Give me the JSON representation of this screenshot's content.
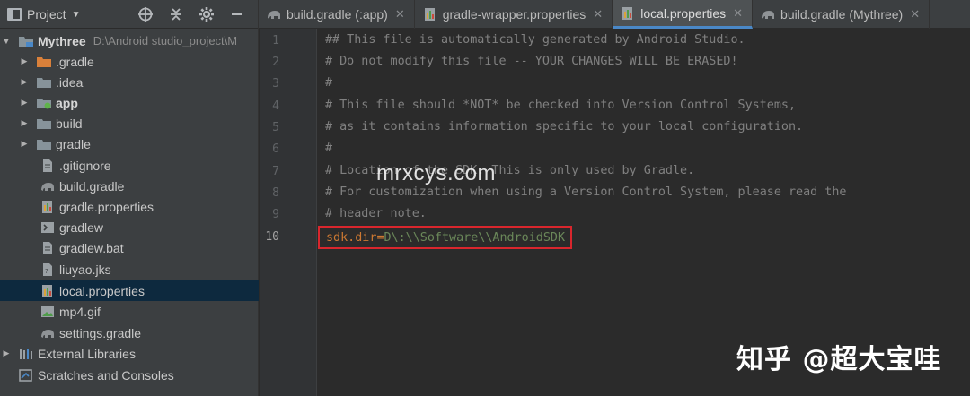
{
  "project_panel": {
    "title": "Project",
    "tools": [
      "crosshair-icon",
      "collapse-icon",
      "gear-icon",
      "minimize-icon"
    ]
  },
  "tabs": [
    {
      "label": "build.gradle (:app)",
      "icon": "gradle-elephant-icon",
      "active": false
    },
    {
      "label": "gradle-wrapper.properties",
      "icon": "properties-file-icon",
      "active": false
    },
    {
      "label": "local.properties",
      "icon": "properties-file-icon",
      "active": true
    },
    {
      "label": "build.gradle (Mythree)",
      "icon": "gradle-elephant-icon",
      "active": false
    }
  ],
  "tree": [
    {
      "label": "Mythree",
      "path": "D:\\Android studio_project\\M",
      "icon": "module-folder-icon",
      "indent": 0,
      "expanded": true,
      "bold": true
    },
    {
      "label": ".gradle",
      "icon": "orange-folder-icon",
      "indent": 1,
      "expanded": false
    },
    {
      "label": ".idea",
      "icon": "folder-icon",
      "indent": 1,
      "expanded": false
    },
    {
      "label": "app",
      "icon": "android-module-folder-icon",
      "indent": 1,
      "expanded": false,
      "bold": true
    },
    {
      "label": "build",
      "icon": "folder-icon",
      "indent": 1,
      "expanded": false
    },
    {
      "label": "gradle",
      "icon": "folder-icon",
      "indent": 1,
      "expanded": false
    },
    {
      "label": ".gitignore",
      "icon": "text-file-icon",
      "indent": 2
    },
    {
      "label": "build.gradle",
      "icon": "gradle-elephant-icon",
      "indent": 2
    },
    {
      "label": "gradle.properties",
      "icon": "properties-file-icon",
      "indent": 2
    },
    {
      "label": "gradlew",
      "icon": "terminal-file-icon",
      "indent": 2
    },
    {
      "label": "gradlew.bat",
      "icon": "text-file-icon",
      "indent": 2
    },
    {
      "label": "liuyao.jks",
      "icon": "keystore-file-icon",
      "indent": 2
    },
    {
      "label": "local.properties",
      "icon": "properties-file-icon",
      "indent": 2,
      "selected": true
    },
    {
      "label": "mp4.gif",
      "icon": "image-file-icon",
      "indent": 2
    },
    {
      "label": "settings.gradle",
      "icon": "gradle-elephant-icon",
      "indent": 2
    },
    {
      "label": "External Libraries",
      "icon": "libraries-icon",
      "indent": 0,
      "expanded": false
    },
    {
      "label": "Scratches and Consoles",
      "icon": "scratches-icon",
      "indent": 0
    }
  ],
  "editor": {
    "current_line": 10,
    "lines": [
      "## This file is automatically generated by Android Studio.",
      "# Do not modify this file -- YOUR CHANGES WILL BE ERASED!",
      "#",
      "# This file should *NOT* be checked into Version Control Systems,",
      "# as it contains information specific to your local configuration.",
      "#",
      "# Location of the SDK. This is only used by Gradle.",
      "# For customization when using a Version Control System, please read the",
      "# header note."
    ],
    "last_line": {
      "key": "sdk.dir",
      "eq": "=",
      "value": "D\\:\\\\Software\\\\AndroidSDK"
    }
  },
  "watermark": "mrxcys.com",
  "brand": "知乎 @超大宝哇",
  "colors": {
    "tree_bg": "#3c3f41",
    "editor_bg": "#2b2b2b",
    "selection_bg": "#0d293e",
    "comment": "#808080",
    "key": "#cc7832",
    "value": "#6a8759",
    "highlight_box": "#d9262d",
    "active_tab_accent": "#4a88c7"
  }
}
